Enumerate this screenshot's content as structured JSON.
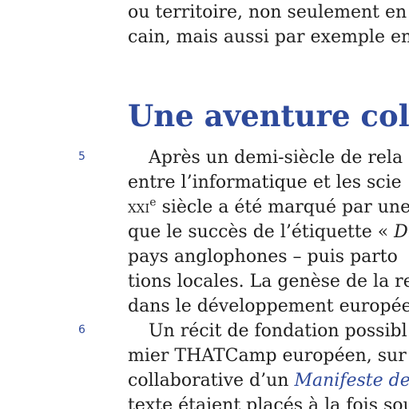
{
  "top_lines": [
    "ou territoire, non seulement en",
    "cain, mais aussi par exemple en"
  ],
  "section_heading": "Une aventure collec",
  "paragraph_numbers": [
    "5",
    "6"
  ],
  "paragraph5": {
    "line1": "Après un demi-siècle de rela",
    "line2": "entre l’informatique et les scie",
    "line3_century": "xxi",
    "line3_sup": "e",
    "line3_rest": " siècle a été marqué par une",
    "line4_pre": "que le succès de l’étiquette « ",
    "line4_italic": "Dig",
    "line5": "pays anglophones – puis parto",
    "line6": "tions locales. La genèse de la re",
    "line7": "dans le développement européen"
  },
  "paragraph6": {
    "line1": "Un récit de fondation possibl",
    "line2": "mier THATCamp européen, sur",
    "line3_pre": "collaborative d’un ",
    "line3_link": "Manifeste de",
    "line4": "texte étaient placés à la fois sous"
  },
  "colors": {
    "accent": "#2e4a9b",
    "text": "#1f1f1f"
  }
}
